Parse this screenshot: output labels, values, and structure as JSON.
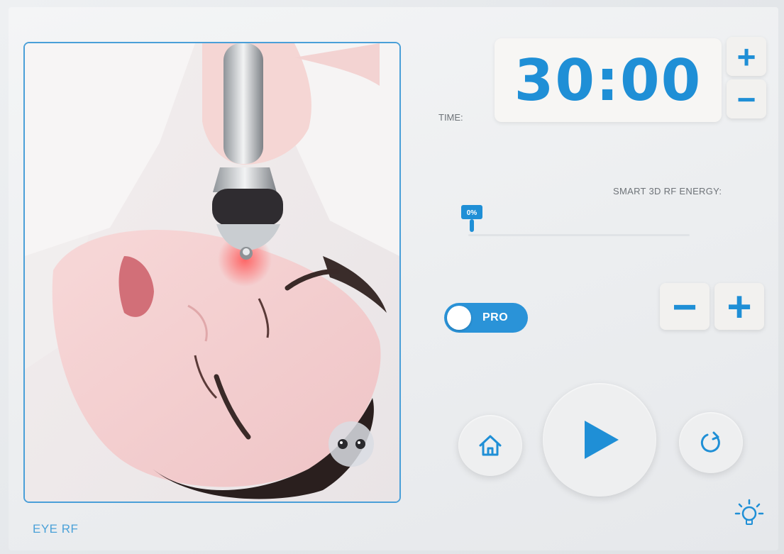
{
  "timer": {
    "label": "TIME:",
    "value": "30:00",
    "plus_label": "+",
    "minus_label": "−"
  },
  "energy": {
    "label": "SMART 3D RF ENERGY:",
    "handle_badge": "0%",
    "level_percent": 0,
    "minus_label": "−",
    "plus_label": "+"
  },
  "mode_toggle": {
    "label": "PRO",
    "state": "on"
  },
  "treatment": {
    "mode_label": "EYE RF"
  },
  "icons": {
    "home": "home-icon",
    "play": "play-icon",
    "reset": "reset-icon",
    "light": "lightbulb-icon",
    "probe": "eye-rf-probe-icon"
  },
  "colors": {
    "accent": "#1f8fd6",
    "frame": "#4a9fd8",
    "label": "#6e7378"
  }
}
